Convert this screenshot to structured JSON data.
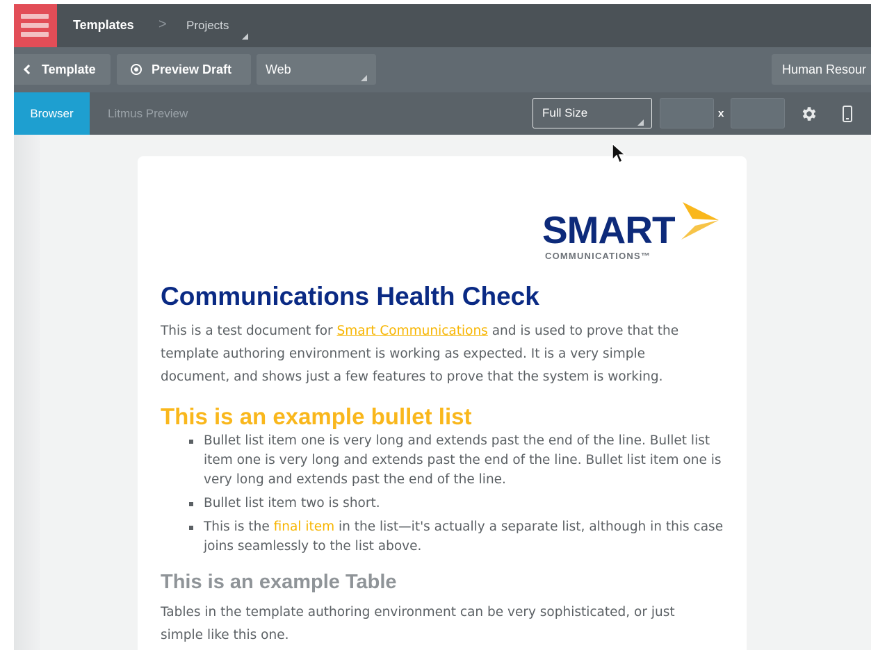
{
  "topbar": {
    "breadcrumb": [
      "Templates",
      "Projects"
    ],
    "separator": ">"
  },
  "toolbar": {
    "back_label": "Template",
    "preview_label": "Preview Draft",
    "channel": "Web",
    "project": "Human Resour"
  },
  "preview_bar": {
    "tabs": [
      "Browser",
      "Litmus Preview"
    ],
    "size_option": "Full Size",
    "width_value": "",
    "height_value": "",
    "dimension_separator": "x"
  },
  "document": {
    "logo": {
      "wordmark": "SMART",
      "tagline": "COMMUNICATIONS™",
      "brand_color": "#0d2a7a",
      "accent_color": "#f9b71c"
    },
    "title": "Communications Health Check",
    "intro": {
      "before": "This is a test document for ",
      "link": "Smart Communications",
      "after": " and is used to prove that the template authoring environment is working as expected. It is a very simple document, and shows just a few features to prove that the system is working."
    },
    "bullets_heading": "This is an example bullet list",
    "bullets": [
      {
        "text": "Bullet list item one is very long and extends past the end of the line. Bullet list item one is very long and extends past the end of the line. Bullet list item one is very long and extends past the end of the line."
      },
      {
        "text": "Bullet list item two is short."
      },
      {
        "before": "This is the ",
        "highlight": "final item",
        "after": " in the list—it's actually a separate list, although in this case joins seamlessly to the list above."
      }
    ],
    "table_heading": "This is an example Table",
    "table_intro": "Tables in the template authoring environment can be very sophisticated, or just simple like this one."
  },
  "icons": {
    "menu": "hamburger-icon",
    "back": "chevron-left-icon",
    "preview": "eye-icon",
    "settings": "gear-icon",
    "device": "mobile-phone-icon",
    "pointer": "mouse-cursor-icon"
  }
}
